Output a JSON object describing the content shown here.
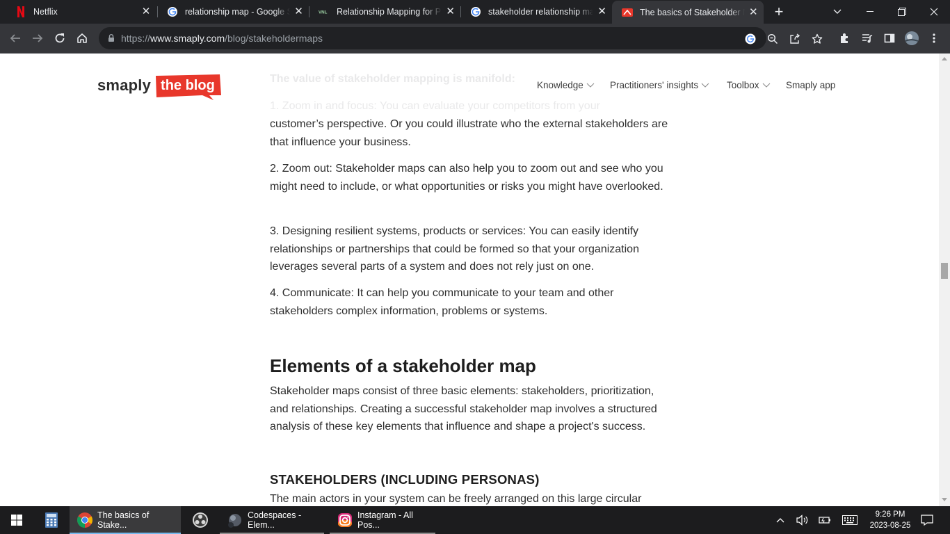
{
  "tabs": [
    {
      "title": "Netflix",
      "favicon": "netflix-icon"
    },
    {
      "title": "relationship map - Google Search",
      "favicon": "google-icon"
    },
    {
      "title": "Relationship Mapping for Public Health",
      "favicon": "vnl-icon"
    },
    {
      "title": "stakeholder relationship map - Google Search",
      "favicon": "google-icon"
    },
    {
      "title": "The basics of Stakeholder Maps",
      "favicon": "smaply-icon",
      "active": true
    }
  ],
  "toolbar": {
    "url_prefix": "https://",
    "url_domain": "www.smaply.com",
    "url_path": "/blog/stakeholdermaps"
  },
  "site": {
    "brand": "smaply",
    "badge": "the blog",
    "badge_color": "#e8372b",
    "nav": [
      "Knowledge",
      "Practitioners' insights",
      "Toolbox",
      "Smaply app"
    ]
  },
  "article": {
    "faded_line1": "The value of stakeholder mapping is manifold:",
    "faded_line2": "1. Zoom in and focus: You can evaluate your competitors from your",
    "p1_rest": "customer’s perspective. Or you could illustrate who the external stakeholders are that influence your business.",
    "p2": "2. Zoom out: Stakeholder maps can also help you to zoom out and see who you might need to include, or what opportunities or risks you might have overlooked.",
    "p3": "3. Designing resilient systems, products or services: You can easily identify relationships or partnerships that could be formed so that your organization leverages several parts of a system and does not rely just on one.",
    "p4": "4. Communicate: It can help you communicate to your team and other stakeholders complex information, problems or systems.",
    "h2": "Elements of a stakeholder map",
    "p5": "Stakeholder maps consist of three basic elements: stakeholders, prioritization, and relationships. Creating a successful stakeholder map involves a structured analysis of these key elements that influence and shape a project's success.",
    "h3": "STAKEHOLDERS (INCLUDING PERSONAS)",
    "p6": "The main actors in your system can be freely arranged on this large circular"
  },
  "taskbar": {
    "apps": [
      {
        "label": "The basics of Stake...",
        "icon": "chrome-icon",
        "active": true
      },
      {
        "label": "Codespaces - Elem...",
        "icon": "codespaces-icon"
      },
      {
        "label": "Instagram - All Pos...",
        "icon": "instagram-icon"
      }
    ],
    "time": "9:26 PM",
    "date": "2023-08-25"
  }
}
